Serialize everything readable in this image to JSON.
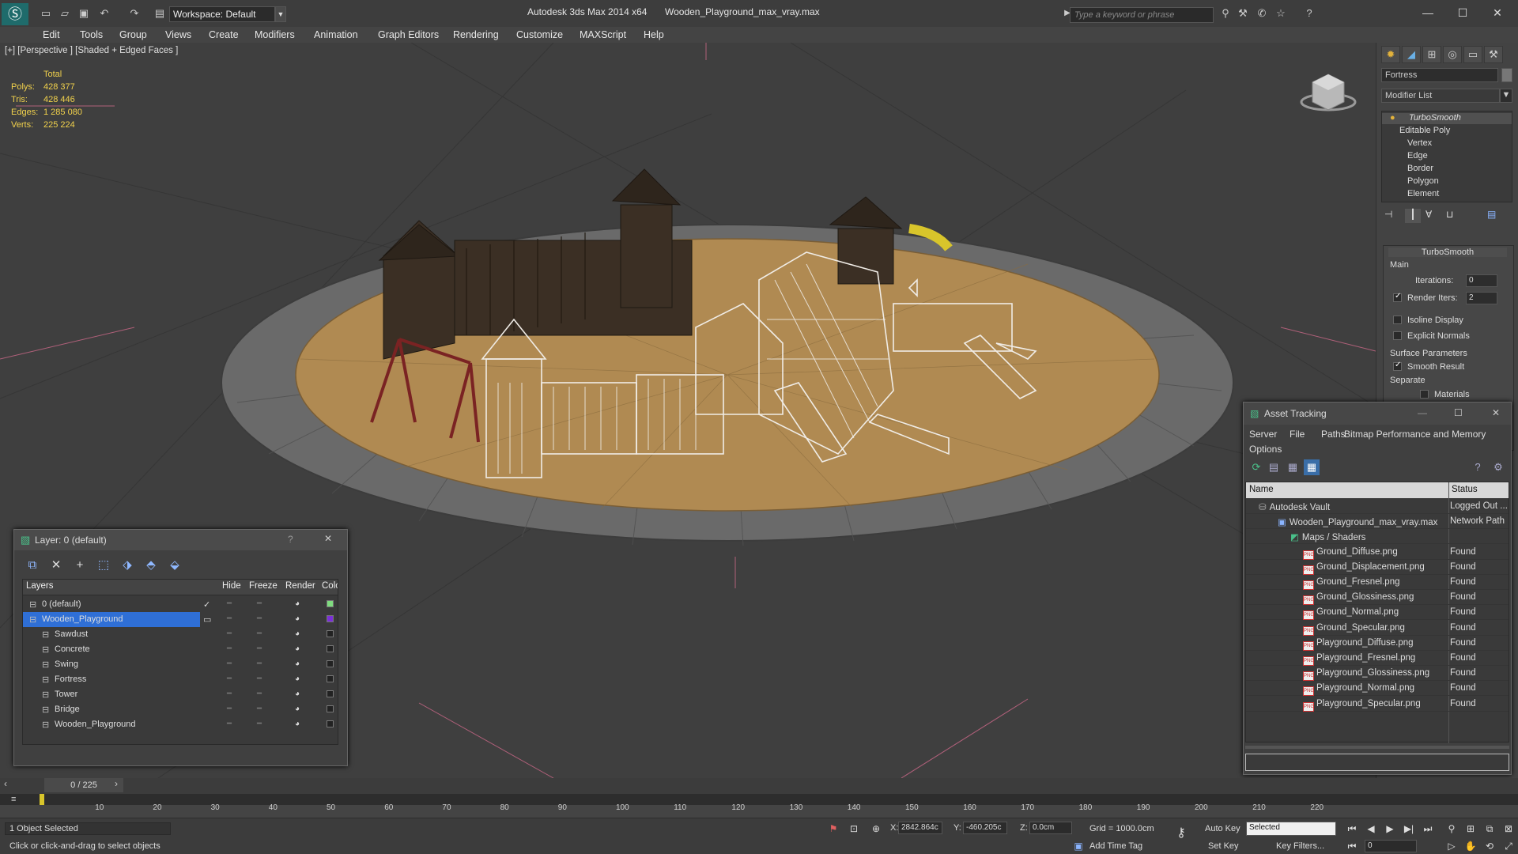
{
  "titlebar": {
    "workspace": "Workspace: Default",
    "app_title": "Autodesk 3ds Max  2014 x64",
    "file_title": "Wooden_Playground_max_vray.max",
    "search_placeholder": "Type a keyword or phrase"
  },
  "menubar": {
    "items": [
      "Edit",
      "Tools",
      "Group",
      "Views",
      "Create",
      "Modifiers",
      "Animation",
      "Graph Editors",
      "Rendering",
      "Customize",
      "MAXScript",
      "Help"
    ]
  },
  "viewport": {
    "label": "[+] [Perspective ] [Shaded + Edged Faces ]",
    "stats": {
      "header": "Total",
      "polys_label": "Polys:",
      "polys": "428 377",
      "tris_label": "Tris:",
      "tris": "428 446",
      "edges_label": "Edges:",
      "edges": "1 285 080",
      "verts_label": "Verts:",
      "verts": "225 224"
    }
  },
  "command_panel": {
    "object_name": "Fortress",
    "modifier_list": "Modifier List",
    "stack": [
      "TurboSmooth",
      "Editable Poly",
      "Vertex",
      "Edge",
      "Border",
      "Polygon",
      "Element"
    ],
    "rollout_title": "TurboSmooth",
    "main_label": "Main",
    "iterations_label": "Iterations:",
    "iterations": "0",
    "render_iters_label": "Render Iters:",
    "render_iters": "2",
    "isoline_label": "Isoline Display",
    "explicit_normals_label": "Explicit Normals",
    "surface_params_label": "Surface Parameters",
    "smooth_result_label": "Smooth Result",
    "separate_label": "Separate",
    "materials_label": "Materials"
  },
  "layer_window": {
    "title": "Layer: 0 (default)",
    "help": "?",
    "close": "✕",
    "columns": {
      "layers": "Layers",
      "hide": "Hide",
      "freeze": "Freeze",
      "render": "Render",
      "color": "Colo"
    },
    "rows": [
      {
        "name": "0 (default)",
        "color": "#7fdc7f"
      },
      {
        "name": "Wooden_Playground",
        "color": "#7b2fd8"
      },
      {
        "name": "Sawdust",
        "color": "#222222"
      },
      {
        "name": "Concrete",
        "color": "#222222"
      },
      {
        "name": "Swing",
        "color": "#222222"
      },
      {
        "name": "Fortress",
        "color": "#222222"
      },
      {
        "name": "Tower",
        "color": "#222222"
      },
      {
        "name": "Bridge",
        "color": "#222222"
      },
      {
        "name": "Wooden_Playground",
        "color": "#222222"
      }
    ]
  },
  "asset_window": {
    "title": "Asset Tracking",
    "menu": [
      "Server",
      "File",
      "Paths",
      "Bitmap Performance and Memory",
      "Options"
    ],
    "columns": {
      "name": "Name",
      "status": "Status"
    },
    "rows": [
      {
        "name": "Autodesk Vault",
        "status": "Logged Out ..."
      },
      {
        "name": "Wooden_Playground_max_vray.max",
        "status": "Network Path"
      },
      {
        "name": "Maps / Shaders",
        "status": ""
      },
      {
        "name": "Ground_Diffuse.png",
        "status": "Found"
      },
      {
        "name": "Ground_Displacement.png",
        "status": "Found"
      },
      {
        "name": "Ground_Fresnel.png",
        "status": "Found"
      },
      {
        "name": "Ground_Glossiness.png",
        "status": "Found"
      },
      {
        "name": "Ground_Normal.png",
        "status": "Found"
      },
      {
        "name": "Ground_Specular.png",
        "status": "Found"
      },
      {
        "name": "Playground_Diffuse.png",
        "status": "Found"
      },
      {
        "name": "Playground_Fresnel.png",
        "status": "Found"
      },
      {
        "name": "Playground_Glossiness.png",
        "status": "Found"
      },
      {
        "name": "Playground_Normal.png",
        "status": "Found"
      },
      {
        "name": "Playground_Specular.png",
        "status": "Found"
      }
    ]
  },
  "timeline": {
    "frame": "0 / 225",
    "ticks": [
      "10",
      "20",
      "30",
      "40",
      "50",
      "60",
      "70",
      "80",
      "90",
      "100",
      "110",
      "120",
      "130",
      "140",
      "150",
      "160",
      "170",
      "180",
      "190",
      "200",
      "210",
      "220"
    ]
  },
  "statusbar": {
    "selected": "1 Object Selected",
    "prompt": "Click or click-and-drag to select objects",
    "x_label": "X:",
    "x": "2842.864c",
    "y_label": "Y:",
    "y": "-460.205c",
    "z_label": "Z:",
    "z": "0.0cm",
    "grid": "Grid = 1000.0cm",
    "add_time_tag": "Add Time Tag",
    "auto_key": "Auto Key",
    "set_key": "Set Key",
    "selected_set": "Selected",
    "key_filters": "Key Filters...",
    "frame_field": "0"
  }
}
